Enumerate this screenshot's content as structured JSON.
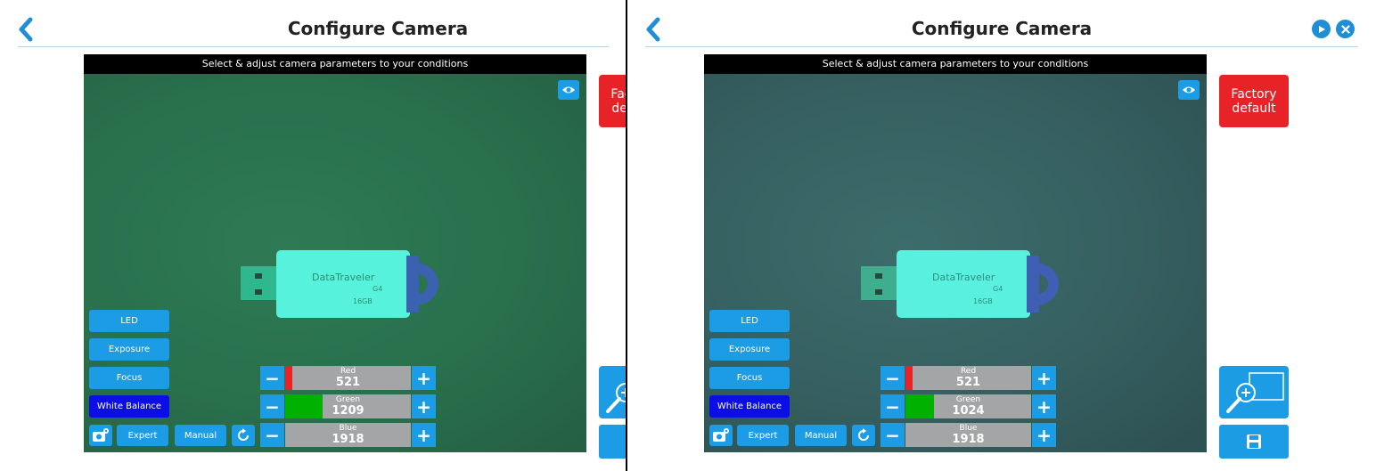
{
  "left_panel": {
    "title": "Configure Camera",
    "instruction": "Select & adjust camera parameters to your conditions",
    "factory_default_label": "Factory default",
    "settings_buttons": {
      "led": "LED",
      "exposure": "Exposure",
      "focus": "Focus",
      "white_balance": "White Balance"
    },
    "mode_buttons": {
      "expert": "Expert",
      "manual": "Manual"
    },
    "sliders": [
      {
        "label": "Red",
        "value": "521",
        "fraction": 0.06,
        "color": "#e72328"
      },
      {
        "label": "Green",
        "value": "1209",
        "fraction": 0.3,
        "color": "#00b100"
      },
      {
        "label": "Blue",
        "value": "1918",
        "fraction": 0.0,
        "color": "#1c9ce4"
      }
    ],
    "usb_label": {
      "brand": "DataTraveler",
      "model": "G4",
      "capacity": "16GB"
    }
  },
  "right_panel": {
    "title": "Configure Camera",
    "instruction": "Select & adjust camera parameters to your conditions",
    "factory_default_label": "Factory default",
    "settings_buttons": {
      "led": "LED",
      "exposure": "Exposure",
      "focus": "Focus",
      "white_balance": "White Balance"
    },
    "mode_buttons": {
      "expert": "Expert",
      "manual": "Manual"
    },
    "sliders": [
      {
        "label": "Red",
        "value": "521",
        "fraction": 0.06,
        "color": "#e72328"
      },
      {
        "label": "Green",
        "value": "1024",
        "fraction": 0.23,
        "color": "#00b100"
      },
      {
        "label": "Blue",
        "value": "1918",
        "fraction": 0.0,
        "color": "#1c9ce4"
      }
    ],
    "usb_label": {
      "brand": "DataTraveler",
      "model": "G4",
      "capacity": "16GB"
    }
  },
  "colors": {
    "accent": "#1c9ce4",
    "active_button": "#0c0ee6",
    "factory_red": "#e72328",
    "slider_track": "#a3a5a6"
  },
  "icons": {
    "back": "chevron-left-icon",
    "next": "play-circle-icon",
    "close": "close-circle-icon",
    "eye": "eye-icon",
    "camera_settings": "camera-gear-icon",
    "reset": "refresh-icon",
    "zoom": "zoom-in-icon",
    "save": "floppy-disk-icon"
  }
}
